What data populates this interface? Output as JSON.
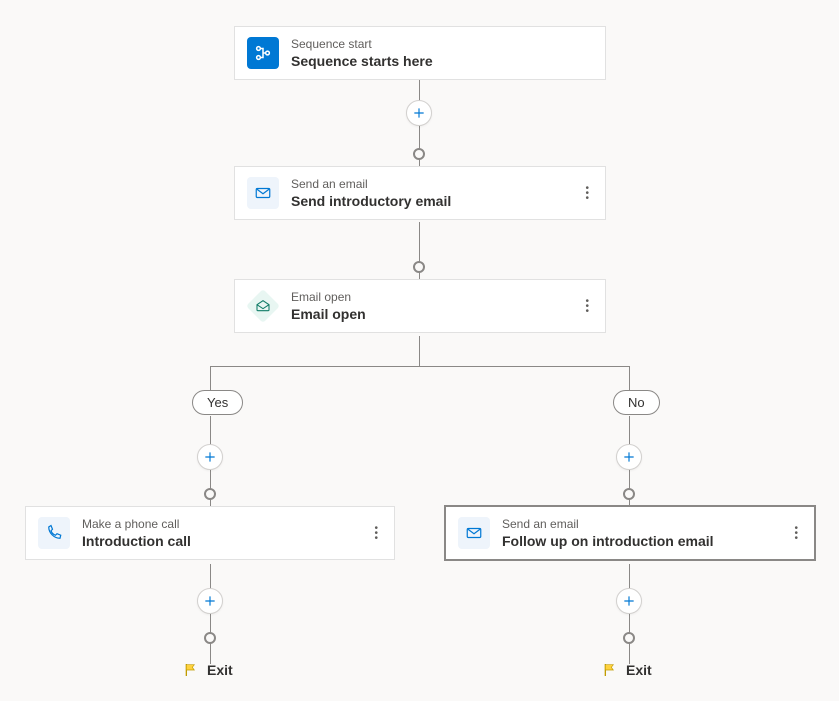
{
  "nodes": {
    "start": {
      "type": "Sequence start",
      "title": "Sequence starts here"
    },
    "email1": {
      "type": "Send an email",
      "title": "Send introductory email"
    },
    "condition": {
      "type": "Email open",
      "title": "Email open"
    },
    "call": {
      "type": "Make a phone call",
      "title": "Introduction call"
    },
    "email2": {
      "type": "Send an email",
      "title": "Follow up on introduction email"
    }
  },
  "branches": {
    "yes": "Yes",
    "no": "No"
  },
  "exit_label": "Exit",
  "colors": {
    "accent": "#0078d4",
    "flag": "#f2c811"
  }
}
